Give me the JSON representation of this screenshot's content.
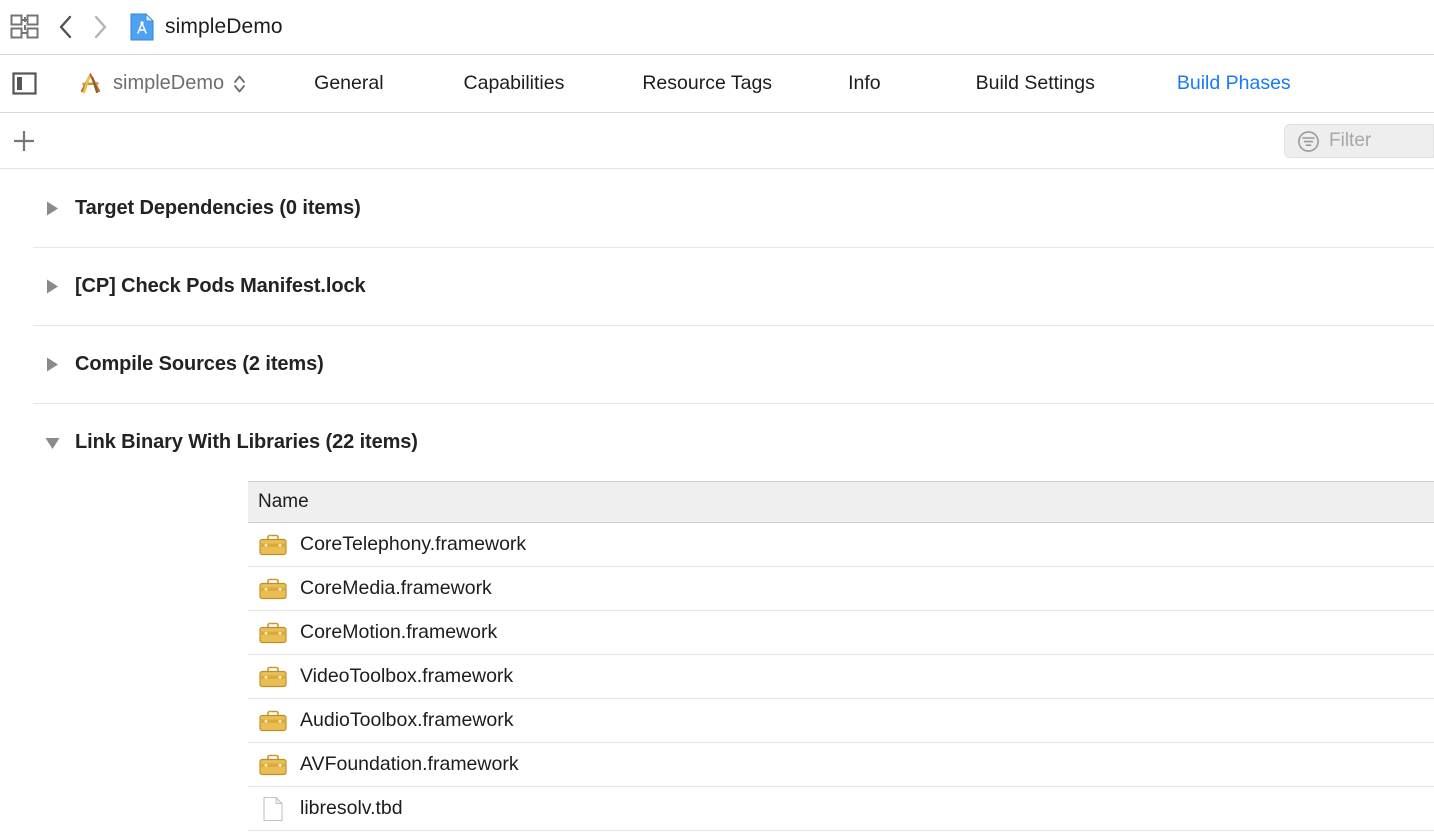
{
  "titlebar": {
    "grid_icon": "grid-panels-icon",
    "back_icon": "chevron-left-icon",
    "forward_icon": "chevron-right-icon",
    "document_icon": "xcode-project-document-icon",
    "document_title": "simpleDemo"
  },
  "tabbar": {
    "panel_toggle_icon": "left-panel-toggle-icon",
    "target_icon": "xcode-target-icon",
    "target_name": "simpleDemo",
    "stepper_icon": "chevron-up-down-icon",
    "active_tab": "Build Phases",
    "tabs": [
      {
        "label": "General",
        "active": false
      },
      {
        "label": "Capabilities",
        "active": false
      },
      {
        "label": "Resource Tags",
        "active": false
      },
      {
        "label": "Info",
        "active": false
      },
      {
        "label": "Build Settings",
        "active": false
      },
      {
        "label": "Build Phases",
        "active": true
      }
    ],
    "active_color": "#197afb"
  },
  "filterbar": {
    "add_icon": "plus-icon",
    "add_label": "+",
    "filter_icon": "filter-funnel-icon",
    "filter_placeholder": "Filter",
    "filter_value": ""
  },
  "phases": [
    {
      "label": "Target Dependencies (0 items)",
      "expanded": false,
      "disclosure_icon": "triangle-right-icon"
    },
    {
      "label": "[CP] Check Pods Manifest.lock",
      "expanded": false,
      "disclosure_icon": "triangle-right-icon"
    },
    {
      "label": "Compile Sources (2 items)",
      "expanded": false,
      "disclosure_icon": "triangle-right-icon"
    },
    {
      "label": "Link Binary With Libraries (22 items)",
      "expanded": true,
      "disclosure_icon": "triangle-down-icon"
    }
  ],
  "libraries_table": {
    "column_header": "Name",
    "rows": [
      {
        "name": "CoreTelephony.framework",
        "icon": "framework-briefcase-icon"
      },
      {
        "name": "CoreMedia.framework",
        "icon": "framework-briefcase-icon"
      },
      {
        "name": "CoreMotion.framework",
        "icon": "framework-briefcase-icon"
      },
      {
        "name": "VideoToolbox.framework",
        "icon": "framework-briefcase-icon"
      },
      {
        "name": "AudioToolbox.framework",
        "icon": "framework-briefcase-icon"
      },
      {
        "name": "AVFoundation.framework",
        "icon": "framework-briefcase-icon"
      },
      {
        "name": "libresolv.tbd",
        "icon": "tbd-document-icon"
      }
    ]
  },
  "colors": {
    "accent_blue": "#197afb",
    "framework_gold": "#e0b040",
    "text": "#1d1d1d",
    "muted_text": "#6e6e6e",
    "separator": "#e6e6e6",
    "header_fill": "#efefef"
  }
}
